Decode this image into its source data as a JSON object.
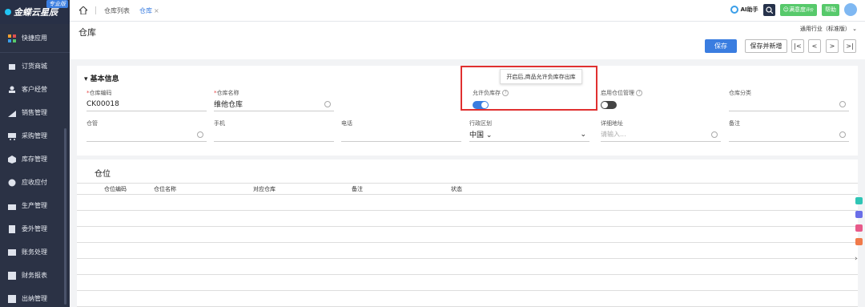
{
  "sidebar": {
    "logo": "金蝶云星辰",
    "badge": "专业版",
    "items": [
      {
        "label": "快捷应用",
        "icon": "grid-icon"
      },
      {
        "label": "订货商城",
        "icon": "store-icon"
      },
      {
        "label": "客户经营",
        "icon": "user-icon"
      },
      {
        "label": "销售管理",
        "icon": "chart-icon"
      },
      {
        "label": "采购管理",
        "icon": "cart-icon"
      },
      {
        "label": "库存管理",
        "icon": "box-icon"
      },
      {
        "label": "应收应付",
        "icon": "money-icon"
      },
      {
        "label": "生产管理",
        "icon": "factory-icon"
      },
      {
        "label": "委外管理",
        "icon": "doc-icon"
      },
      {
        "label": "账务处理",
        "icon": "ledger-icon"
      },
      {
        "label": "财务报表",
        "icon": "report-icon"
      },
      {
        "label": "出纳管理",
        "icon": "cash-icon"
      }
    ]
  },
  "topbar": {
    "tabs": [
      {
        "label": "仓库列表",
        "active": false
      },
      {
        "label": "仓库",
        "active": true,
        "close": "×"
      }
    ],
    "ai_label": "AI助手",
    "satisfaction_label": "满意度",
    "satisfaction_sup": "评价",
    "help_label": "帮助"
  },
  "page": {
    "title": "仓库",
    "industry": "通用行业（标准版）",
    "save_label": "保存",
    "save_new_label": "保存并新增",
    "nav": [
      "|<",
      "<",
      ">",
      ">|"
    ]
  },
  "basic": {
    "title": "基本信息",
    "code_label": "仓库编码",
    "code_value": "CK00018",
    "name_label": "仓库名称",
    "name_value": "维他仓库",
    "negative_label": "允许负库存",
    "location_label": "启用仓位管理",
    "category_label": "仓库分类",
    "manager_label": "仓管",
    "phone_label": "手机",
    "tel_label": "电话",
    "region_label": "行政区划",
    "region_value": "中国",
    "address_label": "详细地址",
    "address_placeholder": "请输入...",
    "remark_label": "备注",
    "tooltip": "开启后,商品允许负库存出库"
  },
  "location": {
    "title": "仓位",
    "columns": [
      "仓位编码",
      "仓位名称",
      "对应仓库",
      "备注",
      "状态"
    ]
  },
  "colors": {
    "accent": "#3a7de0",
    "sidebar": "#2b3245",
    "highlight": "#e03030"
  }
}
